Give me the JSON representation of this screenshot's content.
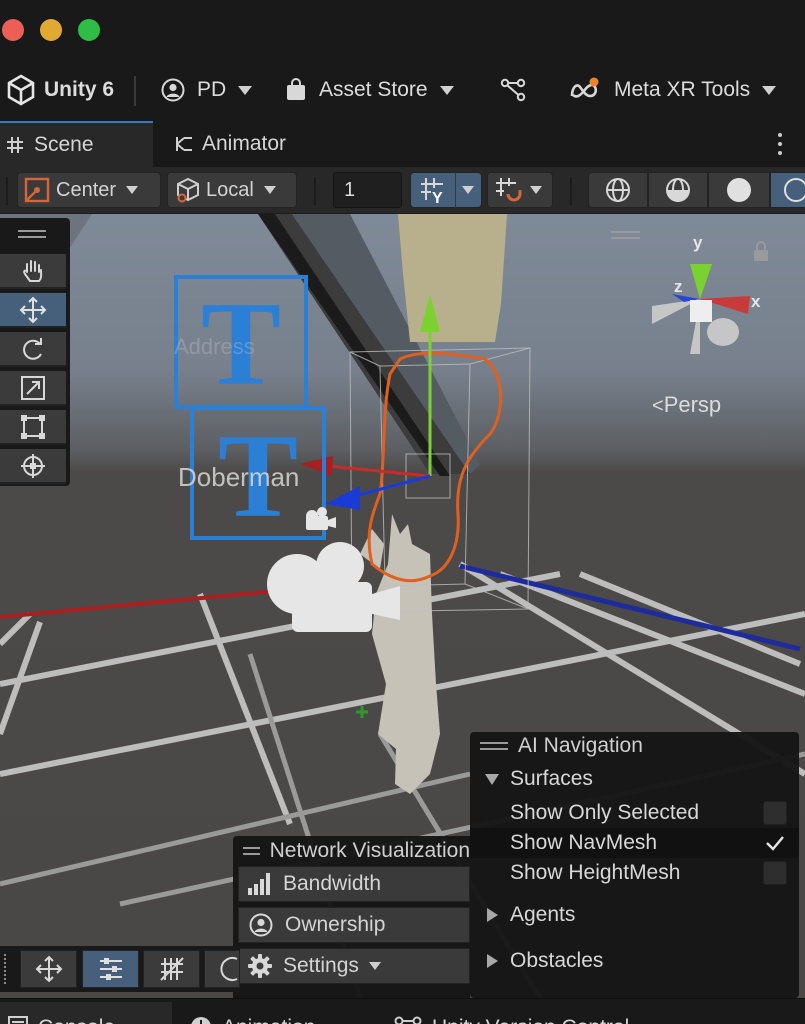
{
  "toolbar": {
    "app_name": "Unity 6",
    "account": "PD",
    "asset_store": "Asset Store",
    "meta_tools": "Meta XR Tools"
  },
  "tabs": [
    {
      "label": "Scene",
      "icon": "grid-icon",
      "active": true
    },
    {
      "label": "Animator",
      "icon": "animator-icon",
      "active": false
    }
  ],
  "scene_toolbar": {
    "pivot_mode": "Center",
    "pivot_rotation": "Local",
    "grid_size": "1"
  },
  "viewport": {
    "projection": "Persp",
    "gizmo_axes": {
      "y": "y",
      "x": "x",
      "z": "z"
    },
    "labels": {
      "address": "Address",
      "name": "Doberman",
      "text_icon": "T"
    },
    "colors": {
      "x_axis": "#c92a2a",
      "y_axis": "#7bd12f",
      "z_axis": "#1a3cd6",
      "selection": "#e06020",
      "accent": "#46607c"
    }
  },
  "ai_navigation": {
    "title": "AI Navigation",
    "surfaces_label": "Surfaces",
    "options": [
      {
        "label": "Show Only Selected",
        "checked": false
      },
      {
        "label": "Show NavMesh",
        "checked": true
      },
      {
        "label": "Show HeightMesh",
        "checked": false
      }
    ],
    "agents_label": "Agents",
    "obstacles_label": "Obstacles"
  },
  "network_visualization": {
    "title": "Network Visualization",
    "items": [
      {
        "label": "Bandwidth",
        "icon": "bandwidth-icon"
      },
      {
        "label": "Ownership",
        "icon": "user-icon"
      },
      {
        "label": "Settings",
        "icon": "gear-icon"
      }
    ]
  },
  "bottom_tabs": [
    {
      "label": "Console",
      "icon": "console-icon",
      "active": true
    },
    {
      "label": "Animation",
      "icon": "clock-icon",
      "active": false
    },
    {
      "label": "Unity Version Control",
      "icon": "branch-icon",
      "active": false
    }
  ]
}
